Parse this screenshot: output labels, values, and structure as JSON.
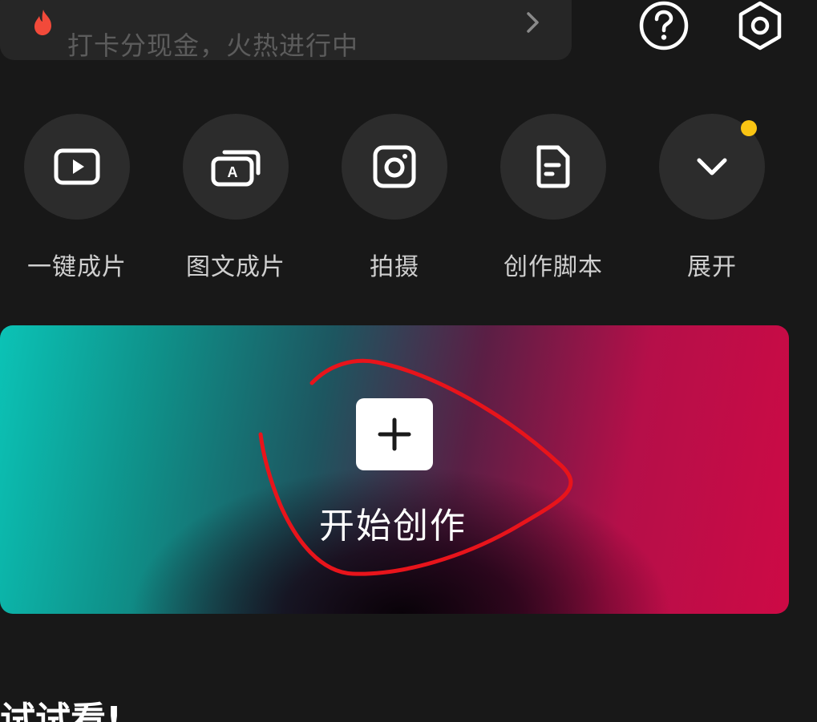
{
  "banner": {
    "text": "打卡分现金，火热进行中",
    "icon_left": "fire-icon",
    "icon_right": "chevron-right-icon"
  },
  "header_icons": [
    "help-icon",
    "settings-icon"
  ],
  "actions": [
    {
      "label": "一键成片",
      "icon": "play-video-icon"
    },
    {
      "label": "图文成片",
      "icon": "text-to-video-icon"
    },
    {
      "label": "拍摄",
      "icon": "camera-icon"
    },
    {
      "label": "创作脚本",
      "icon": "script-document-icon"
    },
    {
      "label": "展开",
      "icon": "chevron-down-icon"
    }
  ],
  "create": {
    "label": "开始创作",
    "icon": "plus-icon"
  },
  "section": {
    "title": "试试看!"
  },
  "colors": {
    "background": "#181818",
    "circle": "#2c2c2c",
    "notify_dot": "#f9c413",
    "annotation": "#e8141b",
    "fire": "#f24a3a",
    "gradient_left": "#0bc3b6",
    "gradient_right": "#cd0a45"
  }
}
